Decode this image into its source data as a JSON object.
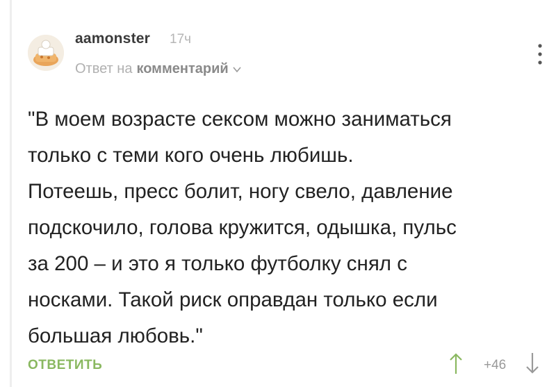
{
  "comment": {
    "author": "aamonster",
    "time": "17ч",
    "reply_prefix": "Ответ на",
    "reply_target": "комментарий",
    "lines": [
      "\"В моем возрасте сексом можно заниматься",
      "только с теми кого очень любишь.",
      "Потеешь, пресс болит, ногу свело, давление",
      "подскочило, голова кружится, одышка, пульс",
      "за 200 – и это я только футболку снял с",
      "носками. Такой риск оправдан только если",
      "большая любовь.\""
    ],
    "reply_button": "ОТВЕТИТЬ",
    "rating": "+46"
  },
  "icons": {
    "avatar": "avatar-image",
    "reply_chevron": "chevron-down-icon",
    "more": "more-vertical-icon",
    "upvote": "arrow-up-icon",
    "downvote": "arrow-down-icon"
  },
  "colors": {
    "text": "#222222",
    "muted": "#b0b0b0",
    "accent_green": "#8ab860",
    "upvote": "#8ab860",
    "downvote": "#999999"
  }
}
